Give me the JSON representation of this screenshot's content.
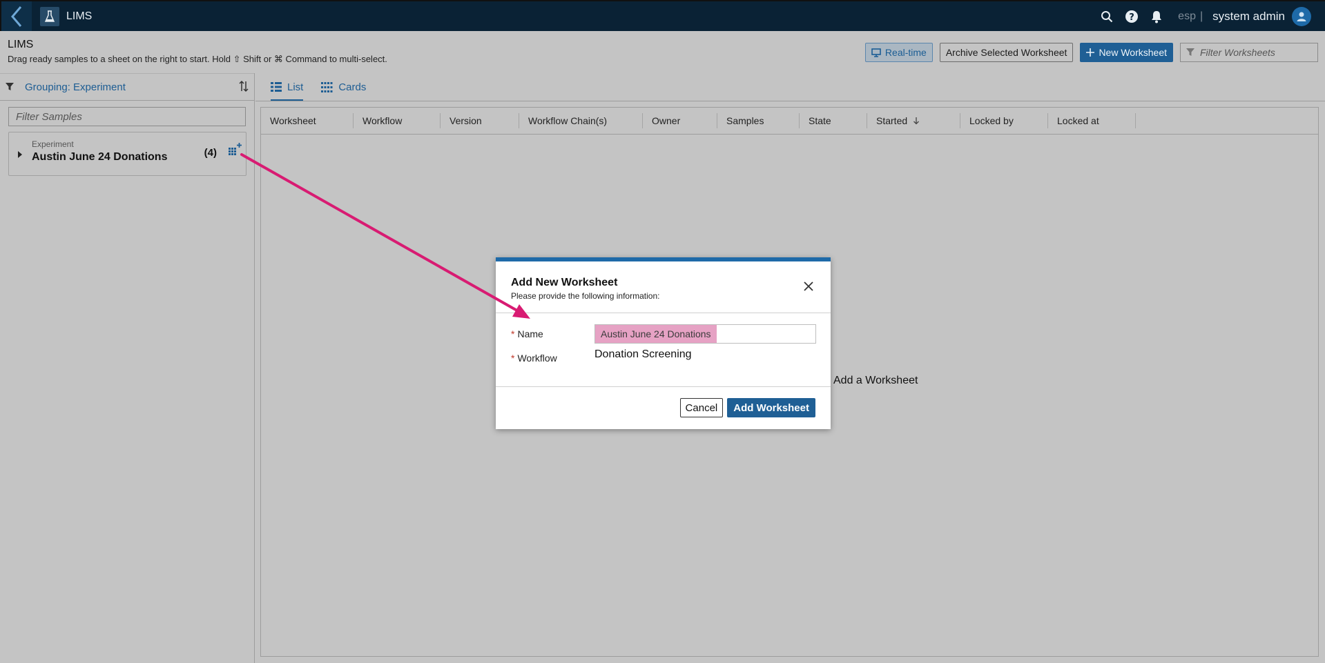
{
  "topbar": {
    "app_name": "LIMS",
    "lang": "esp",
    "separator": "|",
    "user_name": "system admin",
    "icons": [
      "back-chevron-icon",
      "flask-icon",
      "search-icon",
      "help-icon",
      "bell-icon",
      "user-avatar-icon"
    ]
  },
  "header": {
    "title": "LIMS",
    "subtitle": "Drag ready samples to a sheet on the right to start. Hold ⇧ Shift or ⌘ Command to multi-select.",
    "realtime_label": "Real-time",
    "archive_label": "Archive Selected Worksheet",
    "new_worksheet_label": "New Worksheet",
    "filter_placeholder": "Filter Worksheets"
  },
  "left_panel": {
    "grouping_label": "Grouping: Experiment",
    "filter_placeholder": "Filter Samples",
    "experiment": {
      "label": "Experiment",
      "name": "Austin June 24 Donations",
      "count": "(4)"
    }
  },
  "tabs": [
    {
      "label": "List",
      "active": true
    },
    {
      "label": "Cards",
      "active": false
    }
  ],
  "table": {
    "columns": [
      {
        "label": "Worksheet"
      },
      {
        "label": "Workflow"
      },
      {
        "label": "Version"
      },
      {
        "label": "Workflow Chain(s)"
      },
      {
        "label": "Owner"
      },
      {
        "label": "Samples"
      },
      {
        "label": "State"
      },
      {
        "label": "Started",
        "sort": "desc"
      },
      {
        "label": "Locked by"
      },
      {
        "label": "Locked at"
      }
    ],
    "empty_message": "Add a Worksheet"
  },
  "modal": {
    "title": "Add New Worksheet",
    "subtitle": "Please provide the following information:",
    "name_label": "Name",
    "name_value": "Austin June 24 Donations",
    "workflow_label": "Workflow",
    "workflow_value": "Donation Screening",
    "required_marker": "*",
    "cancel_label": "Cancel",
    "add_label": "Add Worksheet"
  },
  "colors": {
    "topbar_bg": "#0a2235",
    "primary": "#1f5f95",
    "modal_accent": "#1e6aa8",
    "highlight": "#e6a2c4",
    "annotation_arrow": "#d81b72",
    "overlay_bg": "#c4c4c4"
  }
}
